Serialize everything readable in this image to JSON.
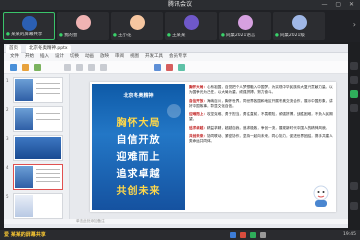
{
  "window": {
    "title": "腾讯会议",
    "controls": "— ▢ ✕"
  },
  "participants": [
    {
      "name": "某某的屏幕共享",
      "avatar_color": "#2b5fb3",
      "active": true
    },
    {
      "name": "我的会",
      "avatar_color": "#f0b3b3",
      "active": false
    },
    {
      "name": "王小花",
      "avatar_color": "#f6c6a0",
      "active": false
    },
    {
      "name": "王某某",
      "avatar_color": "#6f58c9",
      "active": false
    },
    {
      "name": "同桌2021语言",
      "avatar_color": "#d6a0e0",
      "active": false
    },
    {
      "name": "同桌2021级",
      "avatar_color": "#9fb7e6",
      "active": false
    },
    {
      "name": "老班长的老师",
      "avatar_color": "#e8c3d8",
      "active": false
    }
  ],
  "wps": {
    "tabs": [
      "首页",
      "北京冬奥精神.pptx"
    ],
    "menu": [
      "文件",
      "开始",
      "插入",
      "设计",
      "切换",
      "动画",
      "放映",
      "审阅",
      "视图",
      "开发工具",
      "会员专享"
    ],
    "slide_numbers": [
      "1",
      "2",
      "3",
      "4",
      "5"
    ],
    "notes_placeholder": "单击此处添加备注"
  },
  "slide": {
    "poster_title": "北京冬奥精神",
    "slogans": [
      "胸怀大局",
      "自信开放",
      "迎难而上",
      "追求卓越",
      "共创未来"
    ],
    "paragraphs": [
      {
        "lead": "胸怀大局：",
        "text": "心系祖国，自觉把个人梦想融入中国梦，为实现中华民族伟大复兴贡献力量。以为国争光为己任，以大局为重，顽强拼搏，努力奋斗。"
      },
      {
        "lead": "自信开放：",
        "text": "海纳百川，胸怀世界，同世界各国和地区开展冬奥交流合作，展示中国形象，讲好中国故事，彰显文化自信。"
      },
      {
        "lead": "迎难而上：",
        "text": "攻坚克难、勇于担当，勇往直前，不畏艰险，顽强拼搏，战胜困难，不负人民期望。"
      },
      {
        "lead": "追求卓越：",
        "text": "精益求精，超越自我，追求极致，争创一流，展现新时代中国人的精神风貌。"
      },
      {
        "lead": "共创未来：",
        "text": "协同联动、紧密协作，坚持一起向未来，同心协力，促进世界团结，携手共建人类命运共同体。"
      }
    ]
  },
  "taskbar": {
    "label": "爱 某某的屏幕共享",
    "time": "19:45"
  }
}
